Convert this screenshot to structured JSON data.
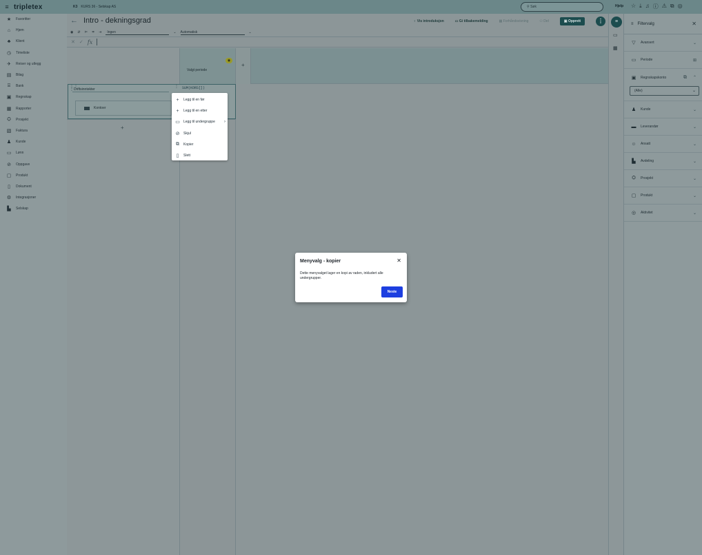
{
  "topbar": {
    "logo": "tripletex",
    "company_code": "K3",
    "company_name": "KURS 36 - Selskap AS",
    "search_placeholder": "Søk",
    "help_label": "Hjelp"
  },
  "sidebar": {
    "items": [
      {
        "label": "Favoritter",
        "icon": "star-icon"
      },
      {
        "label": "Hjem",
        "icon": "home-icon"
      },
      {
        "label": "Klient",
        "icon": "client-icon"
      },
      {
        "label": "Timeliste",
        "icon": "clock-icon"
      },
      {
        "label": "Reiser og utlegg",
        "icon": "plane-icon"
      },
      {
        "label": "Bilag",
        "icon": "voucher-icon"
      },
      {
        "label": "Bank",
        "icon": "bank-icon"
      },
      {
        "label": "Regnskap",
        "icon": "ledger-icon"
      },
      {
        "label": "Rapporter",
        "icon": "report-icon"
      },
      {
        "label": "Prosjekt",
        "icon": "project-icon"
      },
      {
        "label": "Faktura",
        "icon": "invoice-icon"
      },
      {
        "label": "Kunde",
        "icon": "customer-icon"
      },
      {
        "label": "Lønn",
        "icon": "salary-icon"
      },
      {
        "label": "Oppgave",
        "icon": "task-icon"
      },
      {
        "label": "Produkt",
        "icon": "product-icon"
      },
      {
        "label": "Dokument",
        "icon": "document-icon"
      },
      {
        "label": "Integrasjoner",
        "icon": "integration-icon"
      },
      {
        "label": "Selskap",
        "icon": "company-icon"
      }
    ]
  },
  "header": {
    "title": "Intro - dekningsgrad",
    "actions": {
      "intro": "Vis introduksjon",
      "feedback": "Gi tilbakemelding",
      "preview": "Forhåndsvisning",
      "share": "Del",
      "create": "Opprett"
    }
  },
  "toolbar": {
    "style_select": "Ingen",
    "size_select": "Automatisk"
  },
  "formula_bar": {
    "cancel": "✕",
    "confirm": "✓",
    "fx": "fx"
  },
  "grid": {
    "column_header": "Valgt periode",
    "row_label": "Driftsinntekter",
    "row_formula": "SUM(KORS[])",
    "sub_row_label": "Kontoer"
  },
  "context_menu": {
    "items": [
      {
        "label": "Legg til en før",
        "icon": "plus-icon"
      },
      {
        "label": "Legg til en etter",
        "icon": "plus-icon"
      },
      {
        "label": "Legg til undergruppe",
        "icon": "folder-add-icon"
      },
      {
        "label": "Skjul",
        "icon": "eye-off-icon"
      },
      {
        "label": "Kopier",
        "icon": "copy-icon"
      },
      {
        "label": "Slett",
        "icon": "trash-icon"
      }
    ]
  },
  "filter_panel": {
    "title": "Filtervalg",
    "items": {
      "advanced": "Avansert",
      "period": "Periode",
      "account": "Regnskapskonto",
      "account_value": "(Alle)",
      "customer": "Kunde",
      "supplier": "Leverandør",
      "employee": "Ansatt",
      "department": "Avdeling",
      "project": "Prosjekt",
      "product": "Produkt",
      "activity": "Aktivitet"
    }
  },
  "dialog": {
    "title": "Menyvalg - kopier",
    "body": "Dette menyvalget lager en kopi av raden, inkludert alle undergrupper.",
    "next_label": "Neste"
  },
  "colors": {
    "accent": "#1c4c4e",
    "primary_button": "#1d3fe0",
    "overlay_bg": "#8a9699"
  }
}
